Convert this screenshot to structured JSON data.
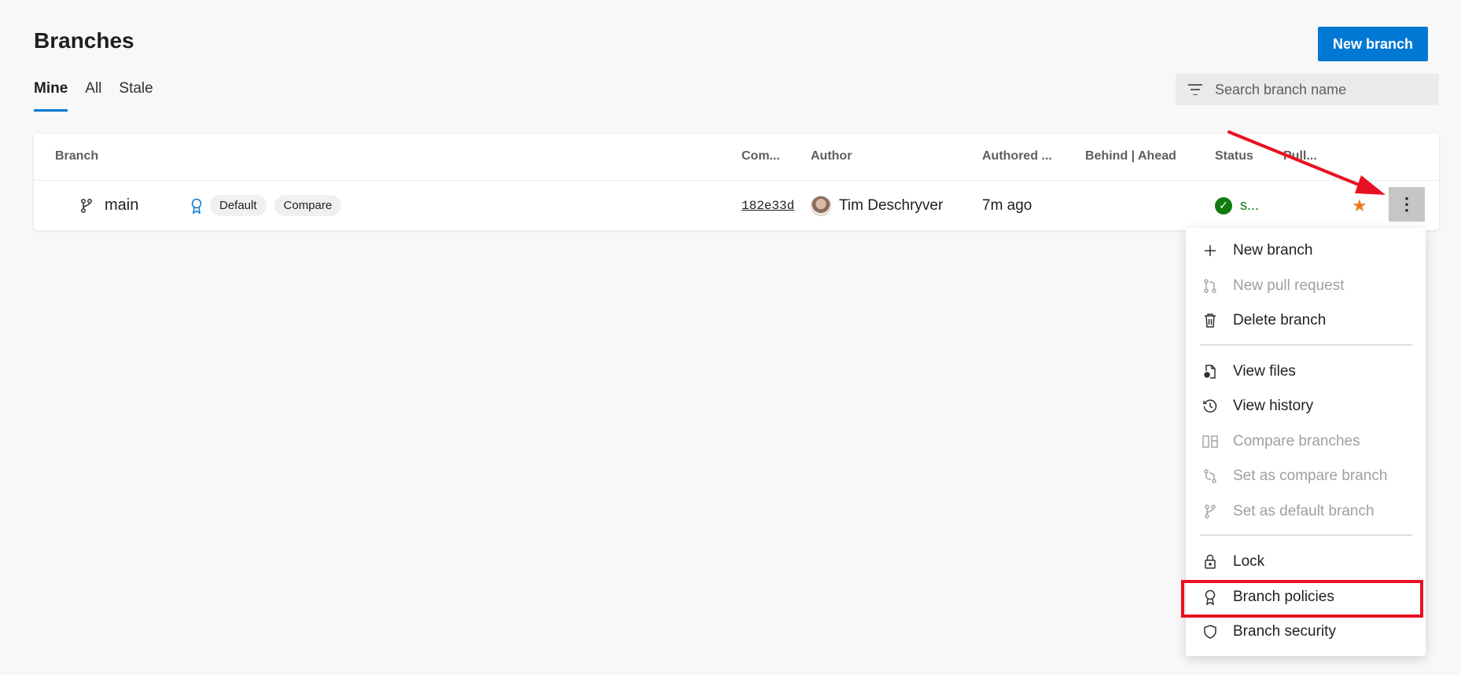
{
  "header": {
    "title": "Branches",
    "new_branch_label": "New branch"
  },
  "tabs": [
    {
      "label": "Mine",
      "active": true
    },
    {
      "label": "All",
      "active": false
    },
    {
      "label": "Stale",
      "active": false
    }
  ],
  "search": {
    "placeholder": "Search branch name",
    "icon": "filter-icon"
  },
  "table": {
    "columns": [
      "Branch",
      "Com...",
      "Author",
      "Authored ...",
      "Behind | Ahead",
      "Status",
      "Pull..."
    ],
    "rows": [
      {
        "branch": "main",
        "policy_icon": "branch-policy-icon",
        "tags": [
          "Default",
          "Compare"
        ],
        "commit": "182e33d",
        "author": "Tim Deschryver",
        "authored": "7m ago",
        "behind_ahead": "",
        "status": "s...",
        "status_icon": "success-check-icon",
        "favorite_icon": "star-icon",
        "favorited": true
      }
    ]
  },
  "context_menu": {
    "items": [
      {
        "label": "New branch",
        "icon": "plus-icon",
        "enabled": true
      },
      {
        "label": "New pull request",
        "icon": "pull-request-icon",
        "enabled": false
      },
      {
        "label": "Delete branch",
        "icon": "trash-icon",
        "enabled": true
      },
      {
        "label": "View files",
        "icon": "view-files-icon",
        "enabled": true
      },
      {
        "label": "View history",
        "icon": "history-icon",
        "enabled": true
      },
      {
        "label": "Compare branches",
        "icon": "compare-icon",
        "enabled": false
      },
      {
        "label": "Set as compare branch",
        "icon": "set-compare-icon",
        "enabled": false
      },
      {
        "label": "Set as default branch",
        "icon": "branch-icon",
        "enabled": false
      },
      {
        "label": "Lock",
        "icon": "lock-icon",
        "enabled": true
      },
      {
        "label": "Branch policies",
        "icon": "policy-ribbon-icon",
        "enabled": true,
        "highlighted": true
      },
      {
        "label": "Branch security",
        "icon": "shield-icon",
        "enabled": true
      }
    ]
  },
  "colors": {
    "accent": "#0078d4",
    "success": "#107c10",
    "star": "#e67e22",
    "annotation": "#e81123"
  }
}
